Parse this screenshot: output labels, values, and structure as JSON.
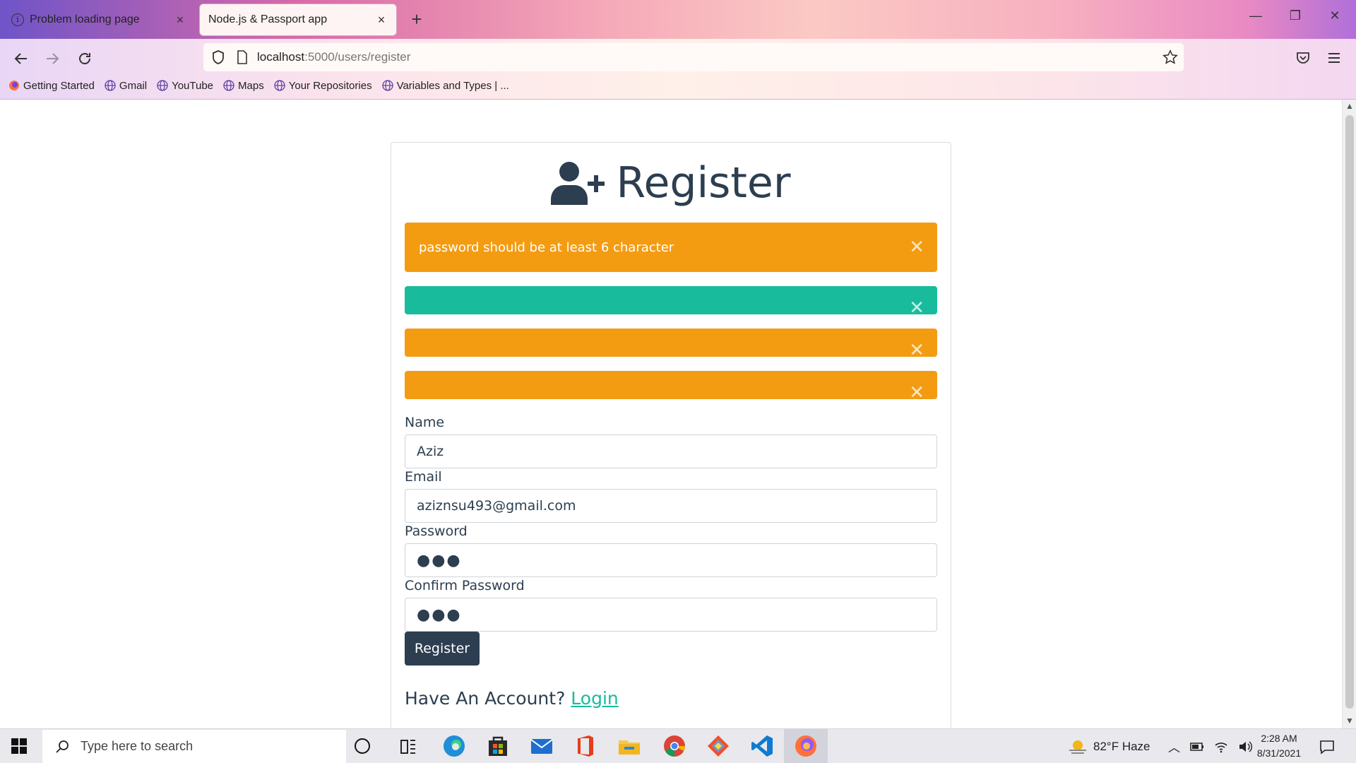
{
  "browser": {
    "tabs": [
      {
        "title": "Problem loading page",
        "active": false
      },
      {
        "title": "Node.js & Passport app",
        "active": true
      }
    ],
    "url_host": "localhost",
    "url_rest": ":5000/users/register",
    "bookmarks": [
      {
        "label": "Getting Started",
        "icon": "firefox-icon"
      },
      {
        "label": "Gmail",
        "icon": "globe-icon"
      },
      {
        "label": "YouTube",
        "icon": "globe-icon"
      },
      {
        "label": "Maps",
        "icon": "globe-icon"
      },
      {
        "label": "Your Repositories",
        "icon": "globe-icon"
      },
      {
        "label": "Variables and Types | ...",
        "icon": "globe-icon"
      }
    ]
  },
  "page": {
    "title": "Register",
    "alerts": [
      {
        "text": "password should be at least 6 character",
        "type": "warning"
      },
      {
        "text": "",
        "type": "success"
      },
      {
        "text": "",
        "type": "warning"
      },
      {
        "text": "",
        "type": "warning"
      }
    ],
    "form": {
      "name_label": "Name",
      "name_value": "Aziz",
      "email_label": "Email",
      "email_value": "aziznsu493@gmail.com",
      "password_label": "Password",
      "password_value": "●●●",
      "confirm_label": "Confirm Password",
      "confirm_value": "●●●",
      "submit_label": "Register"
    },
    "have_account_text": "Have An Account?",
    "login_link": "Login"
  },
  "taskbar": {
    "search_placeholder": "Type here to search",
    "weather": "82°F  Haze",
    "time": "2:28 AM",
    "date": "8/31/2021"
  },
  "colors": {
    "primary": "#2c3e50",
    "warning": "#f39c12",
    "success": "#18bc9c"
  }
}
